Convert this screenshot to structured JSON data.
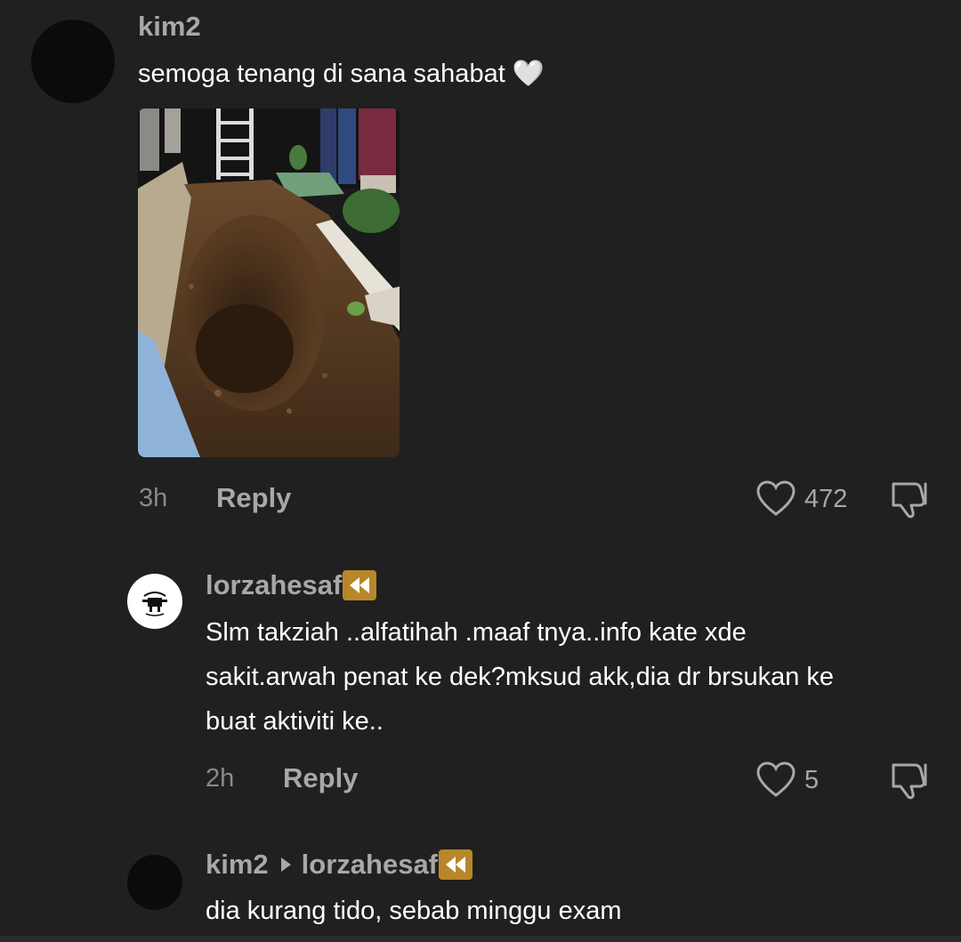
{
  "comments": [
    {
      "username": "kim2",
      "text": "semoga tenang di sana sahabat 🤍",
      "time": "3h",
      "reply_label": "Reply",
      "likes": "472",
      "has_photo": true
    },
    {
      "username": "lorzahesaf",
      "text_lines": [
        "Slm takziah ..alfatihah .maaf tnya..info kate xde",
        "sakit.arwah penat ke dek?mksud akk,dia dr brsukan ke",
        "buat aktiviti ke.."
      ],
      "time": "2h",
      "reply_label": "Reply",
      "likes": "5",
      "badge_icon": "rewind-icon"
    },
    {
      "username": "kim2",
      "reply_to": "lorzahesaf",
      "text": "dia kurang tido, sebab minggu exam",
      "badge_icon": "rewind-icon"
    }
  ],
  "colors": {
    "background": "#202020",
    "username": "#a8a8a8",
    "text": "#ffffff",
    "meta": "#8a8a8a",
    "badge": "#b8872a"
  }
}
